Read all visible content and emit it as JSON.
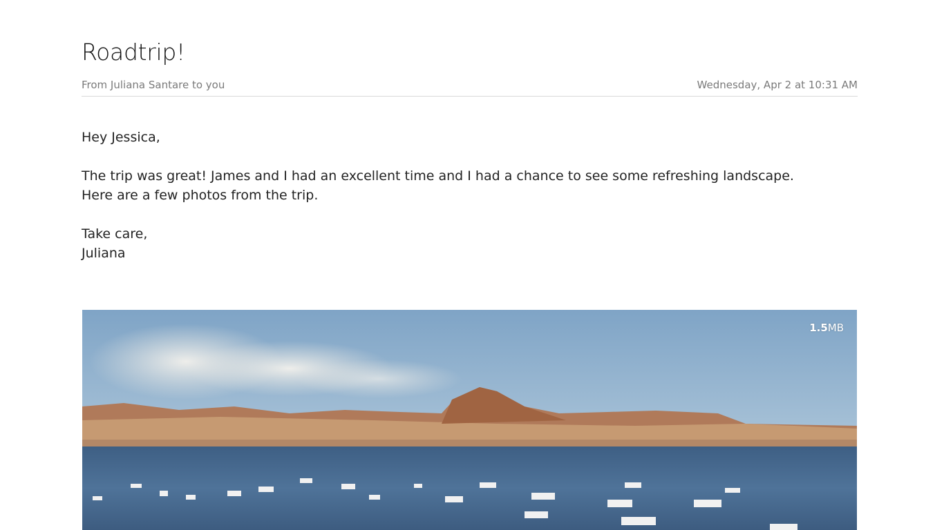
{
  "message": {
    "subject": "Roadtrip!",
    "from_line": "From Juliana Santare to you",
    "date": "Wednesday, Apr 2 at 10:31 AM",
    "body": {
      "greeting": "Hey Jessica,",
      "line1": "The trip was great! James and I had an excellent time and I had a chance to see some refreshing landscape.",
      "line2": "Here are a few photos from the trip.",
      "closing": "Take care,",
      "signature": "Juliana"
    }
  },
  "attachment": {
    "size_value": "1.5",
    "size_unit": "MB"
  }
}
